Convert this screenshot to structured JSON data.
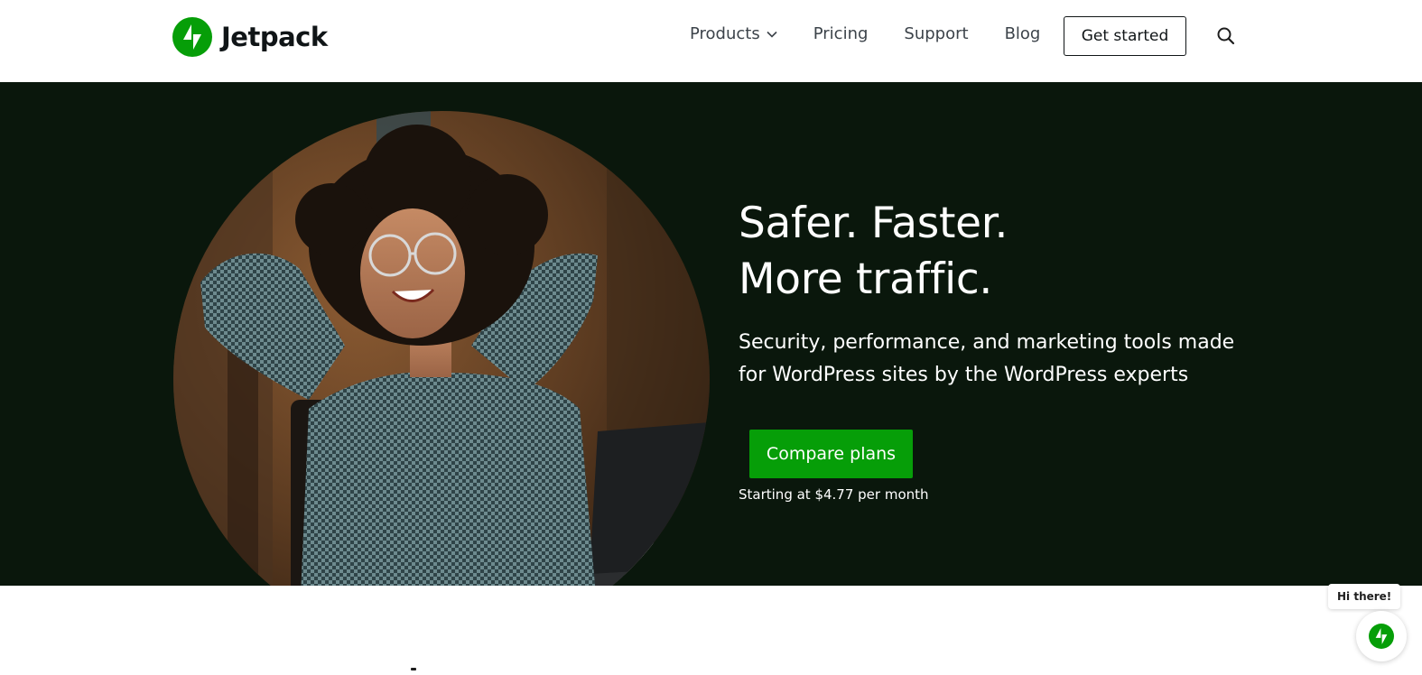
{
  "brand": {
    "name": "Jetpack",
    "color": "#069e08",
    "logo_icon": "jetpack-bolt-icon"
  },
  "nav": {
    "products_label": "Products",
    "pricing_label": "Pricing",
    "support_label": "Support",
    "blog_label": "Blog",
    "cta_label": "Get started",
    "search_icon": "search-icon"
  },
  "hero": {
    "headline_line1": "Safer. Faster.",
    "headline_line2": "More traffic.",
    "subheadline": "Security, performance, and marketing tools made for WordPress sites by the WordPress experts",
    "cta_label": "Compare plans",
    "price_note": "Starting at $4.77 per month",
    "background_color": "#0a170c",
    "cta_color": "#069e08"
  },
  "chat": {
    "greeting": "Hi there!",
    "launcher_icon": "jetpack-bolt-icon"
  }
}
